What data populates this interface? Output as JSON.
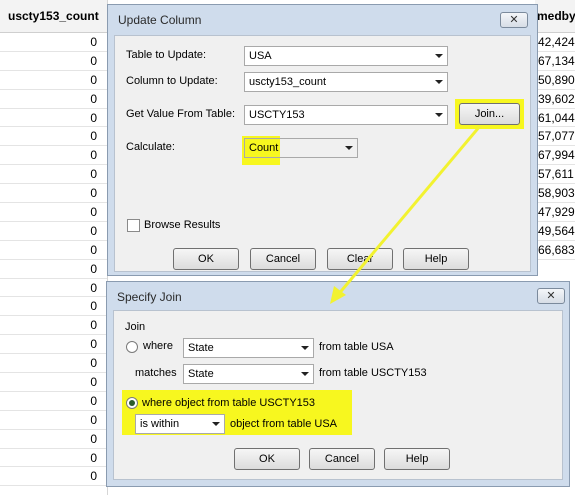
{
  "grid": {
    "left_column": {
      "header": "uscty153_count",
      "cells": [
        "0",
        "0",
        "0",
        "0",
        "0",
        "0",
        "0",
        "0",
        "0",
        "0",
        "0",
        "0",
        "0",
        "0",
        "0",
        "0",
        "0",
        "0",
        "0",
        "0",
        "0",
        "0",
        "0",
        "0"
      ]
    },
    "right_column": {
      "header": "medby",
      "cells": [
        "42,424",
        "67,134",
        "50,890",
        "39,602",
        "61,044",
        "57,077",
        "67,994",
        "57,611",
        "58,903",
        "47,929",
        "49,564",
        "66,683"
      ]
    }
  },
  "update_dialog": {
    "title": "Update Column",
    "close_glyph": "✕",
    "table_label": "Table to Update:",
    "table_value": "USA",
    "column_label": "Column to Update:",
    "column_value": "uscty153_count",
    "value_from_label": "Get Value From Table:",
    "value_from_value": "USCTY153",
    "join_button": "Join...",
    "calculate_label": "Calculate:",
    "calculate_value": "Count",
    "browse_label": "Browse Results",
    "ok": "OK",
    "cancel": "Cancel",
    "clear": "Clear",
    "help": "Help"
  },
  "join_dialog": {
    "title": "Specify Join",
    "close_glyph": "✕",
    "join_label": "Join",
    "where_label": "where",
    "where_value": "State",
    "where_from": "from table USA",
    "matches_label": "matches",
    "matches_value": "State",
    "matches_from": "from table USCTY153",
    "object_radio_label": "where object from table USCTY153",
    "within_value": "is within",
    "object_from": "object from table USA",
    "ok": "OK",
    "cancel": "Cancel",
    "help": "Help"
  },
  "colors": {
    "highlight": "#f7f71f",
    "frame": "#cfdcec",
    "dialog_bg": "#f0f0f0"
  }
}
